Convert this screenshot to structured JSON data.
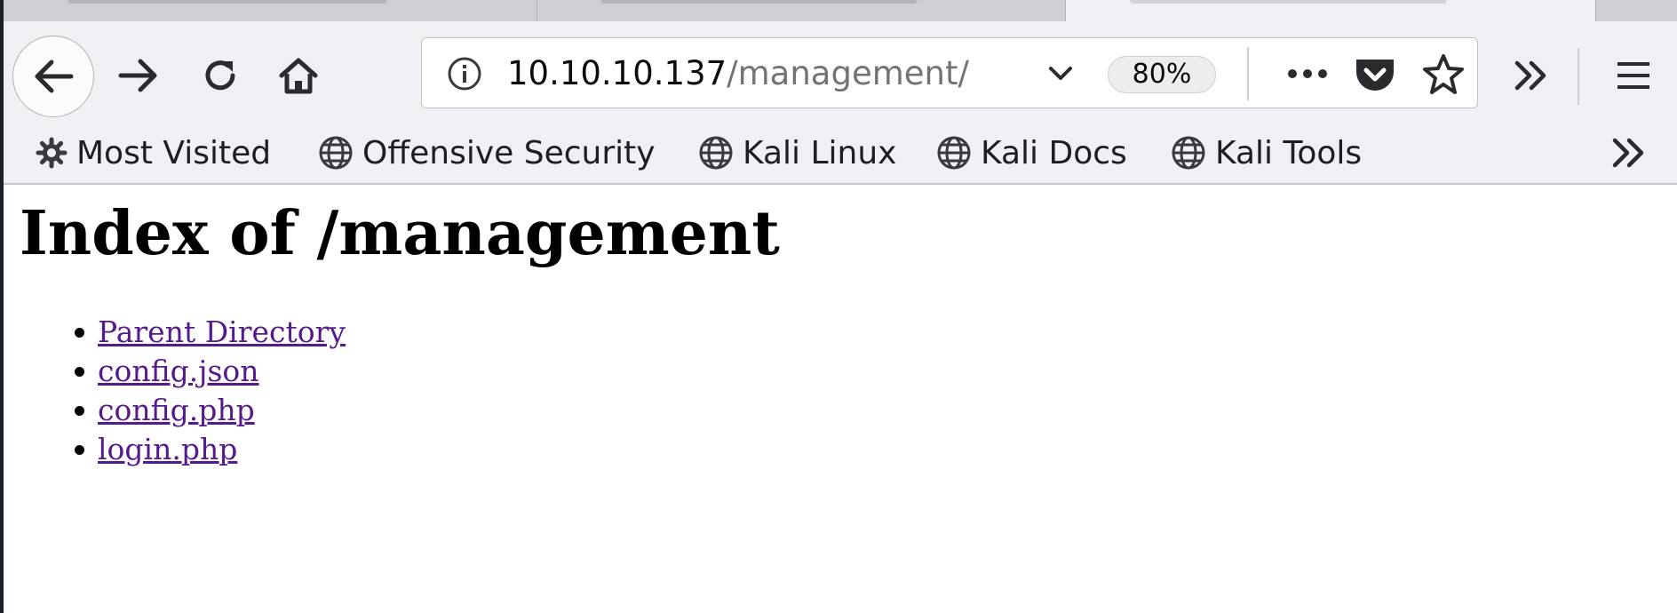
{
  "browser": {
    "url": {
      "host": "10.10.10.137",
      "path": "/management/"
    },
    "zoom": "80%"
  },
  "bookmarks": [
    {
      "label": "Most Visited",
      "icon": "gear-icon"
    },
    {
      "label": "Offensive Security",
      "icon": "globe-icon"
    },
    {
      "label": "Kali Linux",
      "icon": "globe-icon"
    },
    {
      "label": "Kali Docs",
      "icon": "globe-icon"
    },
    {
      "label": "Kali Tools",
      "icon": "globe-icon"
    }
  ],
  "page": {
    "title": "Index of /management",
    "entries": [
      {
        "label": "Parent Directory"
      },
      {
        "label": "config.json"
      },
      {
        "label": "config.php"
      },
      {
        "label": "login.php"
      }
    ]
  },
  "colors": {
    "visited_link": "#551a8b",
    "chrome_background": "#f0f0f4"
  }
}
